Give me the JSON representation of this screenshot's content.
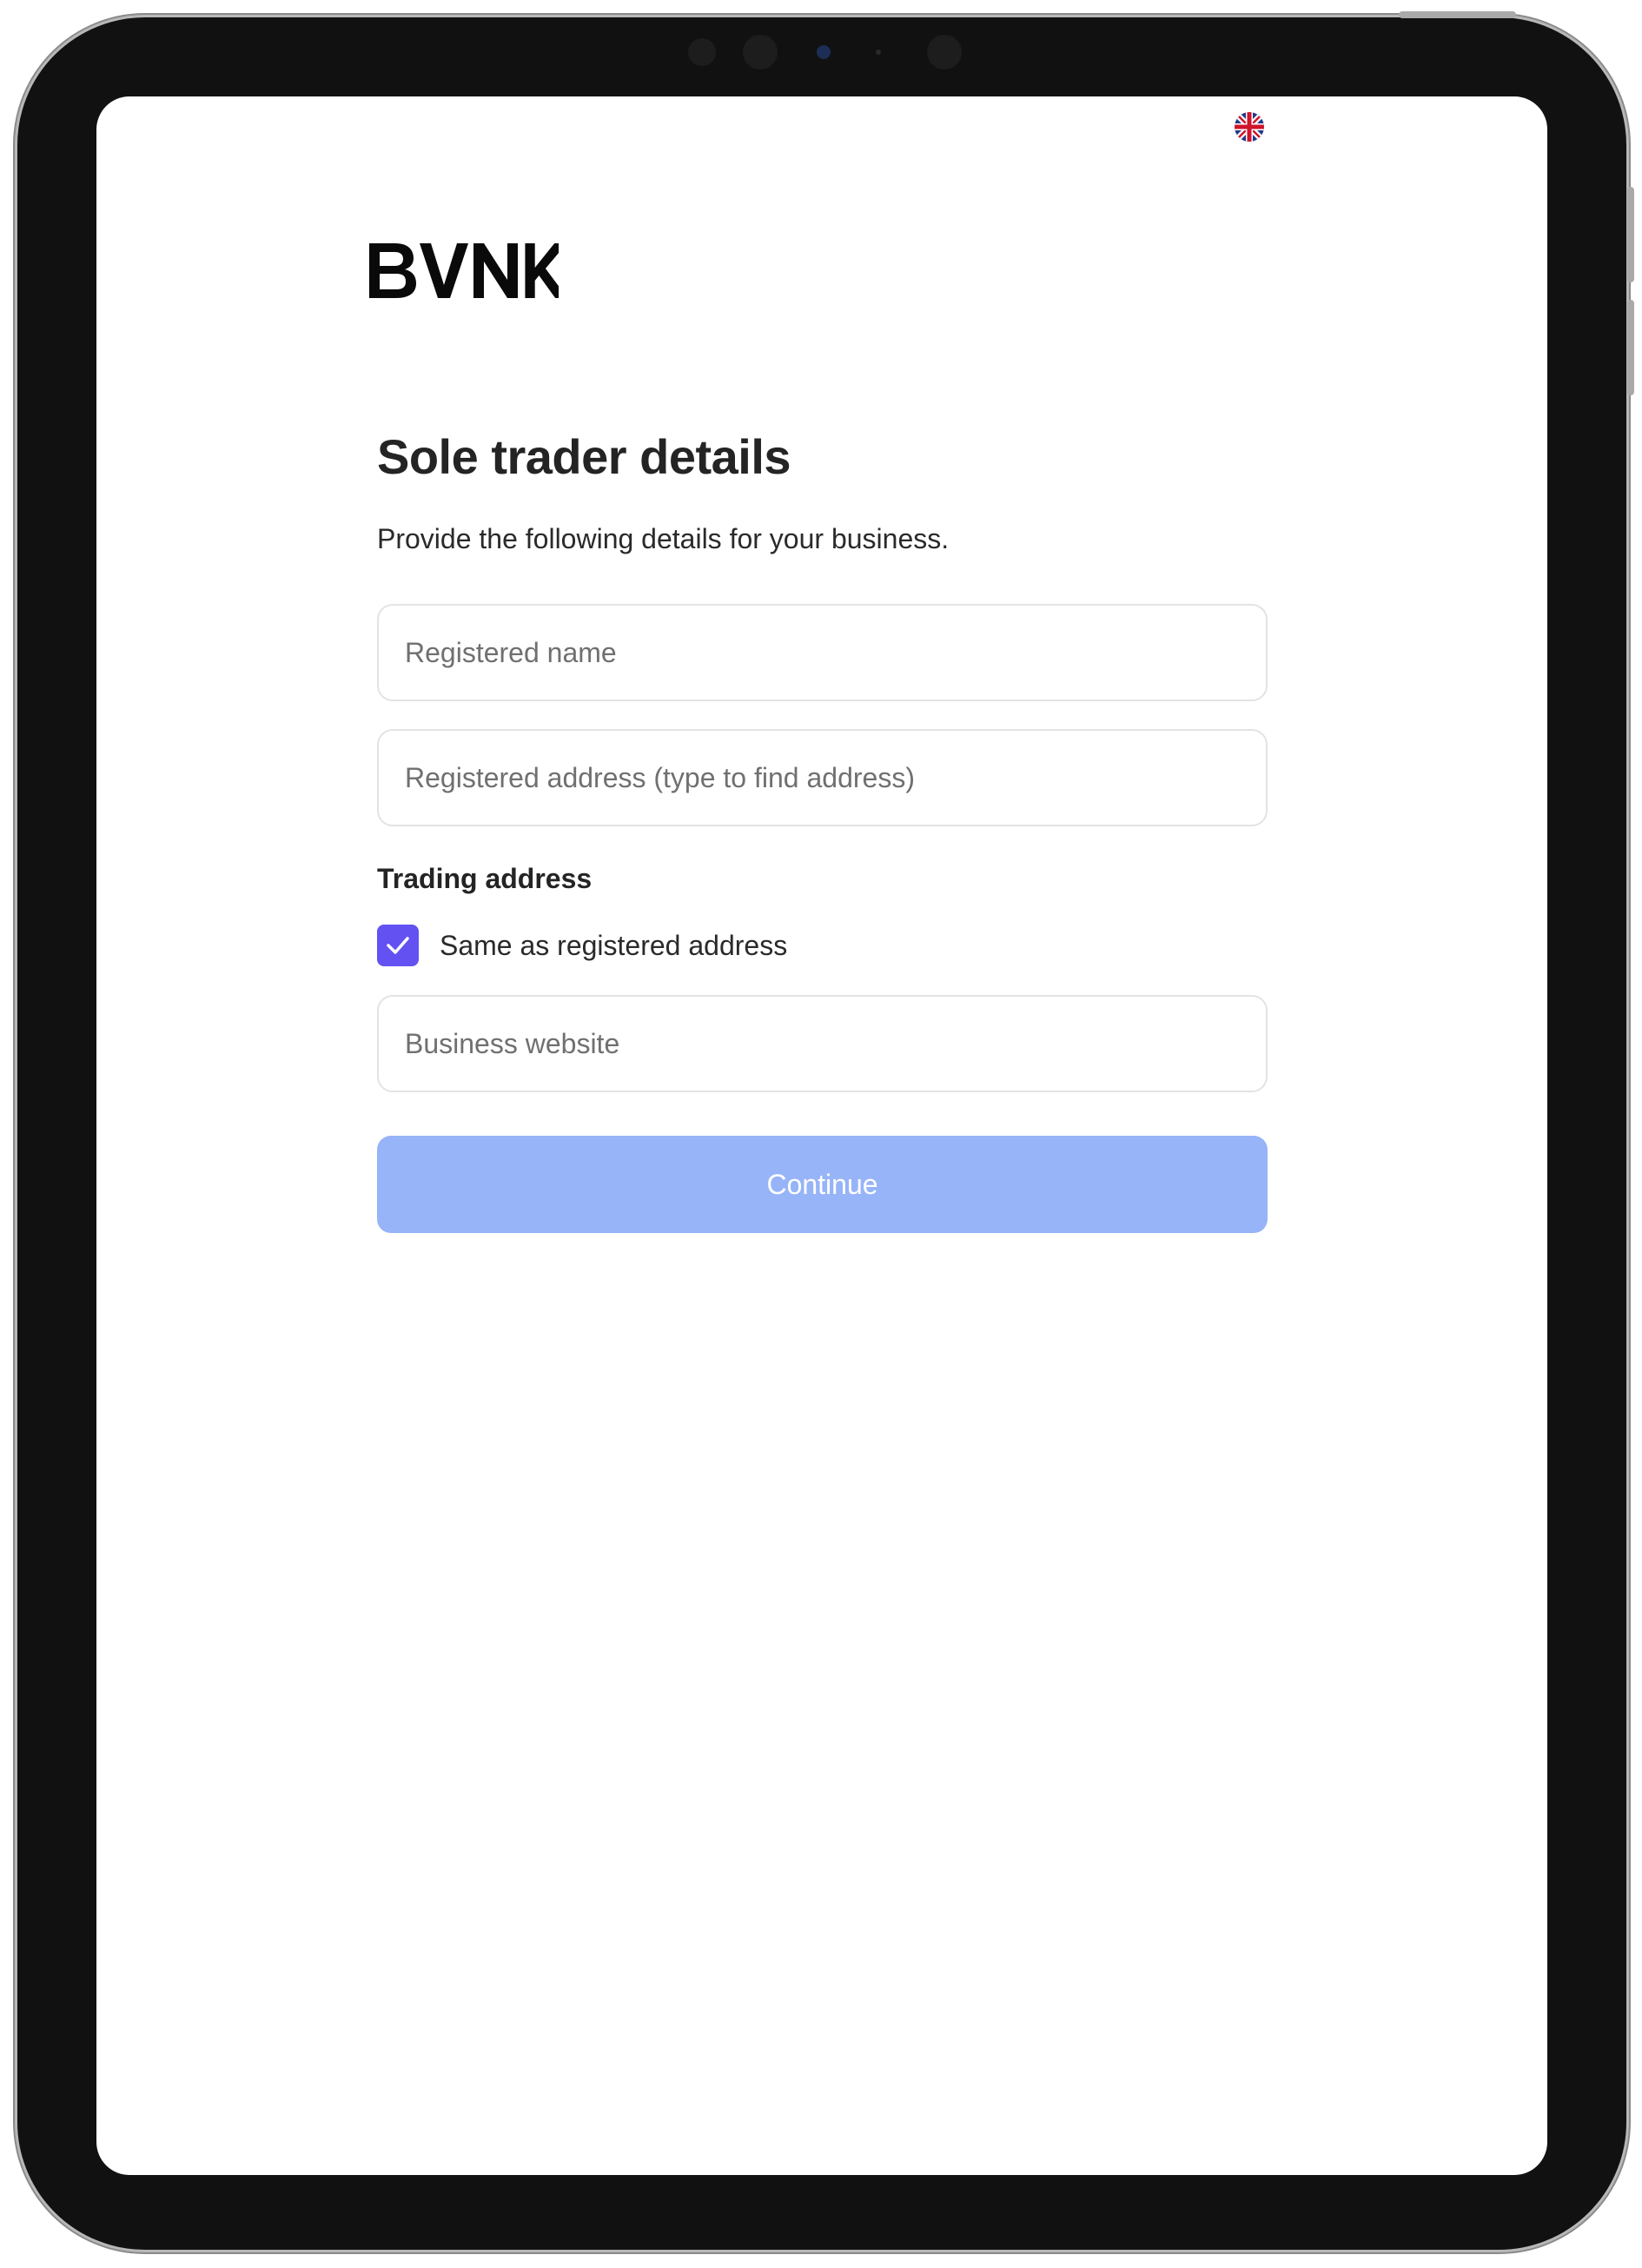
{
  "header": {
    "logo_text": "BVNK",
    "language_flag": "uk-flag-icon"
  },
  "form": {
    "title": "Sole trader details",
    "subtitle": "Provide the following details for your business.",
    "registered_name": {
      "value": "",
      "placeholder": "Registered name"
    },
    "registered_address": {
      "value": "",
      "placeholder": "Registered address (type to find address)"
    },
    "trading_address_label": "Trading address",
    "same_as_registered": {
      "label": "Same as registered address",
      "checked": true
    },
    "business_website": {
      "value": "",
      "placeholder": "Business website"
    },
    "continue_label": "Continue"
  },
  "colors": {
    "accent": "#6351f2",
    "button_disabled": "#97b4f8",
    "text": "#242424",
    "field_border": "#e3e3e3"
  }
}
